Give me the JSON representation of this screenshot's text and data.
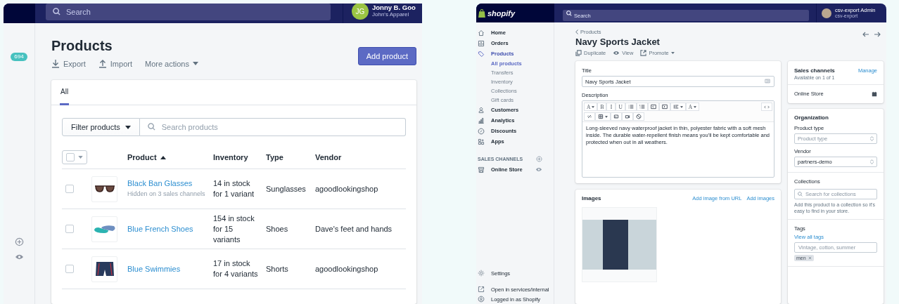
{
  "left_screen": {
    "top_bar": {
      "search_placeholder": "Search",
      "user_initials": "JG",
      "user_name": "Jonny B. Goo",
      "store_name": "John's Apparel"
    },
    "sidebar": {
      "badge": "694"
    },
    "page": {
      "title": "Products",
      "actions": [
        {
          "label": "Export",
          "kind": "export"
        },
        {
          "label": "Import",
          "kind": "import"
        },
        {
          "label": "More actions",
          "kind": "dropdown"
        }
      ],
      "primary_button": "Add product"
    },
    "tabs": [
      {
        "label": "All",
        "selected": true
      }
    ],
    "filter": {
      "button": "Filter products",
      "placeholder": "Search products"
    },
    "table": {
      "select_all": {
        "checked": false
      },
      "columns": [
        {
          "label": "Product",
          "sorted": true
        },
        {
          "label": "Inventory",
          "sorted": false
        },
        {
          "label": "Type",
          "sorted": false
        },
        {
          "label": "Vendor",
          "sorted": false
        }
      ],
      "rows": [
        {
          "checked": false,
          "kind": "sunglasses",
          "name": "Black Ban Glasses",
          "note": "Hidden on 3 sales channels",
          "inventory": "14 in stock for 1 variant",
          "type": "Sunglasses",
          "vendor": "agoodlookingshop"
        },
        {
          "checked": false,
          "kind": "shoes",
          "name": "Blue French Shoes",
          "inventory": "154 in stock for 15 variants",
          "type": "Shoes",
          "vendor": "Dave's feet and hands"
        },
        {
          "checked": false,
          "kind": "shorts",
          "name": "Blue Swimmies",
          "inventory": "17 in stock for 4 variants",
          "type": "Shorts",
          "vendor": "agoodlookingshop"
        }
      ]
    }
  },
  "right_screen": {
    "top_bar": {
      "logo": "shopify",
      "search_placeholder": "Search",
      "user_name": "csv-export Admin",
      "store_name": "csv-export"
    },
    "sidebar": {
      "items": [
        {
          "label": "Home",
          "selected": false
        },
        {
          "label": "Orders",
          "selected": false
        },
        {
          "label": "Products",
          "selected": true,
          "children": [
            {
              "label": "All products",
              "selected": true
            },
            {
              "label": "Transfers",
              "selected": false
            },
            {
              "label": "Inventory",
              "selected": false
            },
            {
              "label": "Collections",
              "selected": false
            },
            {
              "label": "Gift cards",
              "selected": false
            }
          ]
        },
        {
          "label": "Customers",
          "selected": false
        },
        {
          "label": "Analytics",
          "selected": false
        },
        {
          "label": "Discounts",
          "selected": false
        },
        {
          "label": "Apps",
          "selected": false
        }
      ],
      "channels_heading": "SALES CHANNELS",
      "channels": [
        {
          "label": "Online Store"
        }
      ],
      "bottom_items": [
        {
          "label": "Settings"
        },
        {
          "label": "Open in services/internal"
        },
        {
          "label": "Logged in as Shopify"
        }
      ]
    },
    "page": {
      "breadcrumb": "Products",
      "title": "Navy Sports Jacket",
      "actions": [
        {
          "label": "Duplicate",
          "kind": "duplicate"
        },
        {
          "label": "View",
          "kind": "view"
        },
        {
          "label": "Promote",
          "kind": "promote"
        }
      ]
    },
    "product_card": {
      "title_label": "Title",
      "title_value": "Navy Sports Jacket",
      "description_label": "Description",
      "toolbar": [
        {
          "kind": "dropdown",
          "label": "A"
        },
        {
          "kind": "text",
          "label": "B"
        },
        {
          "kind": "text",
          "label": "I"
        },
        {
          "kind": "text",
          "label": "U"
        },
        {
          "kind": "icon"
        },
        {
          "kind": "icon"
        },
        {
          "kind": "icon"
        },
        {
          "kind": "icon"
        },
        {
          "kind": "icon_dropdown"
        },
        {
          "kind": "dropdown",
          "label": "A"
        },
        {
          "kind": "code"
        },
        {
          "kind": "break"
        },
        {
          "kind": "icon"
        },
        {
          "kind": "icon_dropdown"
        },
        {
          "kind": "icon"
        },
        {
          "kind": "icon"
        },
        {
          "kind": "icon"
        }
      ],
      "description": "Long-sleeved navy waterproof jacket in thin, polyester fabric with a soft mesh inside. The durable water-repellent finish means you'll be kept comfortable and protected when out in all weathers."
    },
    "images_card": {
      "title": "Images",
      "links": [
        "Add image from URL",
        "Add images"
      ]
    },
    "sales_channels": {
      "title": "Sales channels",
      "link": "Manage",
      "subtitle": "Available on 1 of 1",
      "channels": [
        "Online Store"
      ]
    },
    "organization": {
      "title": "Organization",
      "product_type_label": "Product type",
      "product_type_placeholder": "Product type",
      "vendor_label": "Vendor",
      "vendor_value": "partners-demo",
      "collections_label": "Collections",
      "collections_placeholder": "Search for collections",
      "collections_help": "Add this product to a collection so it's easy to find in your store.",
      "tags_label": "Tags",
      "tags_link": "View all tags",
      "tags_placeholder": "Vintage, cotton, summer",
      "tags": [
        "men"
      ]
    }
  }
}
